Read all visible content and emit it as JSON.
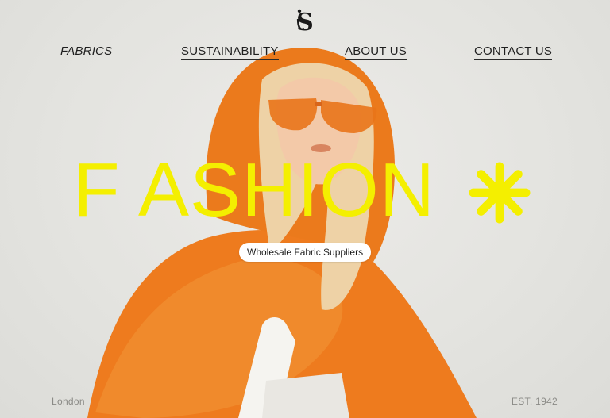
{
  "brand": {
    "logo_icon": "js-monogram-icon"
  },
  "nav": {
    "items": [
      {
        "label": "FABRICS"
      },
      {
        "label": "SUSTAINABILITY"
      },
      {
        "label": "ABOUT US"
      },
      {
        "label": "CONTACT US"
      }
    ]
  },
  "hero": {
    "headline": "F ASHION",
    "accent_icon": "asterisk-icon",
    "accent_color": "#f4ef00",
    "tagline": "Wholesale Fabric Suppliers"
  },
  "footer": {
    "location": "London",
    "established": "EST. 1942"
  }
}
